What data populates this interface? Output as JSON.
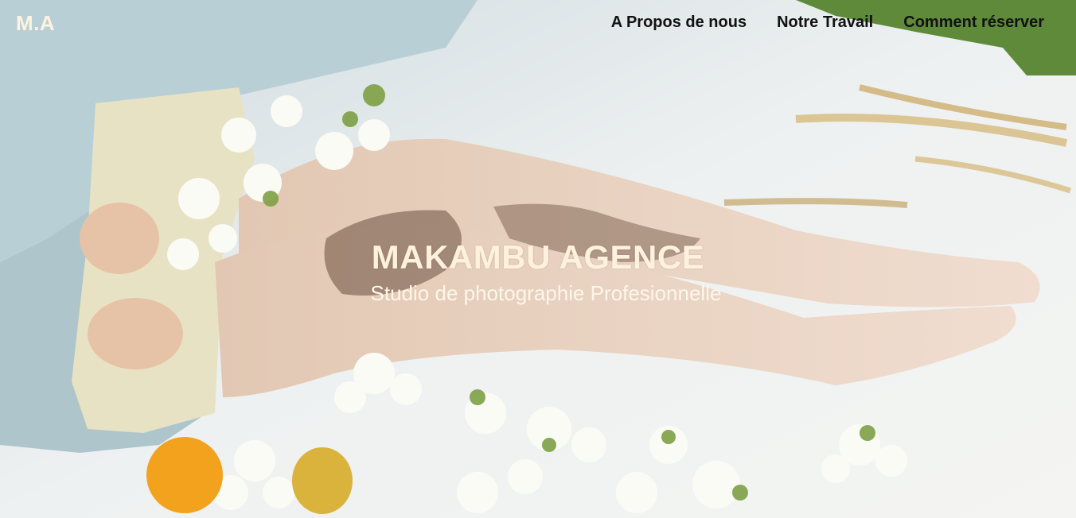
{
  "brand": {
    "logo_text": "M.A"
  },
  "nav": {
    "items": [
      {
        "label": "A Propos de nous"
      },
      {
        "label": "Notre Travail"
      },
      {
        "label": "Comment réserver"
      }
    ]
  },
  "hero": {
    "title": "MAKAMBU AGENCE",
    "subtitle": "Studio de photographie Profesionnelle"
  },
  "colors": {
    "logo": "#fff3df",
    "nav_text": "#111111",
    "title": "#fff1dc"
  }
}
